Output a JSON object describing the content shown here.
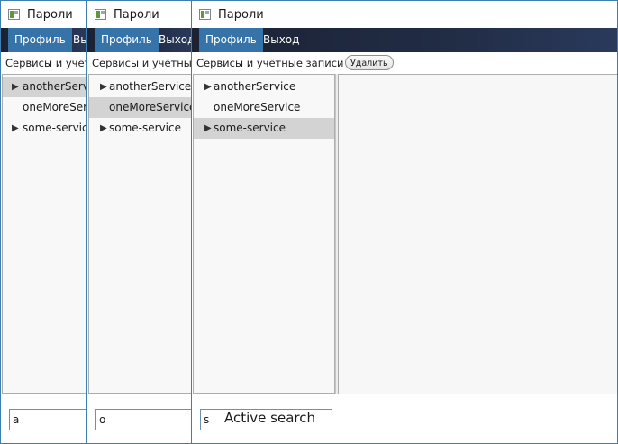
{
  "windows": [
    {
      "title": "Пароли",
      "menu": [
        "Профиль",
        "Выход"
      ],
      "toolbar_label": "Сервисы и учётные записи",
      "tree": [
        {
          "label": "anotherService",
          "expandable": true,
          "selected": true
        },
        {
          "label": "oneMoreService",
          "expandable": false,
          "selected": false
        },
        {
          "label": "some-service",
          "expandable": true,
          "selected": false
        }
      ],
      "search_value": "a"
    },
    {
      "title": "Пароли",
      "menu": [
        "Профиль",
        "Выход"
      ],
      "toolbar_label": "Сервисы и учётные записи",
      "tree": [
        {
          "label": "anotherService",
          "expandable": true,
          "selected": false
        },
        {
          "label": "oneMoreService",
          "expandable": false,
          "selected": true
        },
        {
          "label": "some-service",
          "expandable": true,
          "selected": false
        }
      ],
      "search_value": "o"
    },
    {
      "title": "Пароли",
      "menu": [
        "Профиль",
        "Выход"
      ],
      "toolbar_label": "Сервисы и учётные записи",
      "delete_button": "Удалить",
      "tree": [
        {
          "label": "anotherService",
          "expandable": true,
          "selected": false
        },
        {
          "label": "oneMoreService",
          "expandable": false,
          "selected": false
        },
        {
          "label": "some-service",
          "expandable": true,
          "selected": true
        }
      ],
      "search_value": "s",
      "search_caption": "Active search"
    }
  ],
  "icons": {
    "expand_arrow": "▶",
    "splitter_grip": "⋮"
  },
  "colors": {
    "menu_bg": "#212c45",
    "menu_active": "#3573a8",
    "selection": "#d3d3d3",
    "window_border": "#3c7fb1"
  }
}
